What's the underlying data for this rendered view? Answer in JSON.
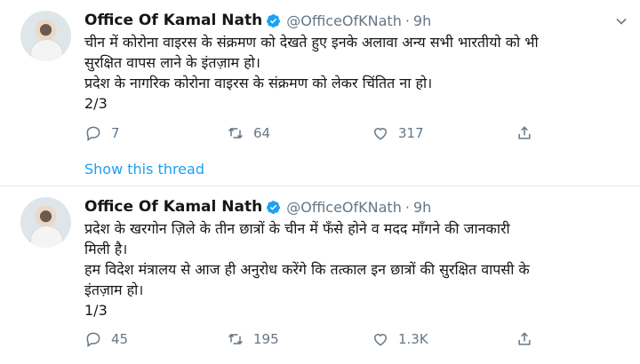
{
  "tweets": [
    {
      "name": "Office Of Kamal Nath",
      "handle": "@OfficeOfKNath",
      "dot": "·",
      "time": "9h",
      "lines": [
        "चीन में कोरोना वाइरस के संक्रमण को देखते हुए इनके अलावा अन्य सभी भारतीयो को भी",
        "सुरक्षित वापस लाने के इंतज़ाम हो।",
        "प्रदेश के नागरिक कोरोना वाइरस के संक्रमण को लेकर चिंतित ना हो।",
        "2/3"
      ],
      "replies": "7",
      "retweets": "64",
      "likes": "317",
      "show_thread": "Show this thread"
    },
    {
      "name": "Office Of Kamal Nath",
      "handle": "@OfficeOfKNath",
      "dot": "·",
      "time": "9h",
      "lines": [
        "प्रदेश के खरगोन ज़िले के तीन छात्रों के चीन में फँसे होने व मदद माँगने की जानकारी",
        "मिली है।",
        "हम विदेश मंत्रालय से आज ही अनुरोध करेंगे कि तत्काल इन छात्रों की सुरक्षित वापसी के",
        "इंतज़ाम हो।",
        "1/3"
      ],
      "replies": "45",
      "retweets": "195",
      "likes": "1.3K"
    }
  ],
  "colors": {
    "accent": "#1da1f2",
    "muted": "#657786",
    "text": "#14171a"
  },
  "icons": [
    "verified-icon",
    "chevron-down-icon",
    "reply-icon",
    "retweet-icon",
    "like-icon",
    "share-icon"
  ]
}
